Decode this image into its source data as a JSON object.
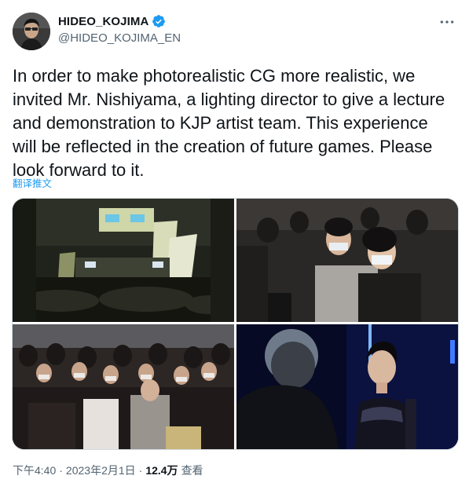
{
  "author": {
    "display_name": "HIDEO_KOJIMA",
    "handle": "@HIDEO_KOJIMA_EN",
    "verified": true
  },
  "icons": {
    "verified": "verified-badge-icon",
    "more": "more-options-icon"
  },
  "tweet": {
    "text": "In order to make photorealistic CG more realistic, we invited Mr. Nishiyama, a lighting director to give a lecture and demonstration to KJP artist team. This experience will be reflected in the creation of future games. Please look forward to it.",
    "translate_label": "翻译推文"
  },
  "media": {
    "photo_count": 4
  },
  "meta": {
    "time": "下午4:40",
    "separator": "·",
    "date": "2023年2月1日",
    "views_count": "12.4万",
    "views_label": "查看"
  },
  "colors": {
    "accent": "#1d9bf0",
    "text_primary": "#0f1419",
    "text_secondary": "#536471",
    "border": "#cfd9de"
  }
}
